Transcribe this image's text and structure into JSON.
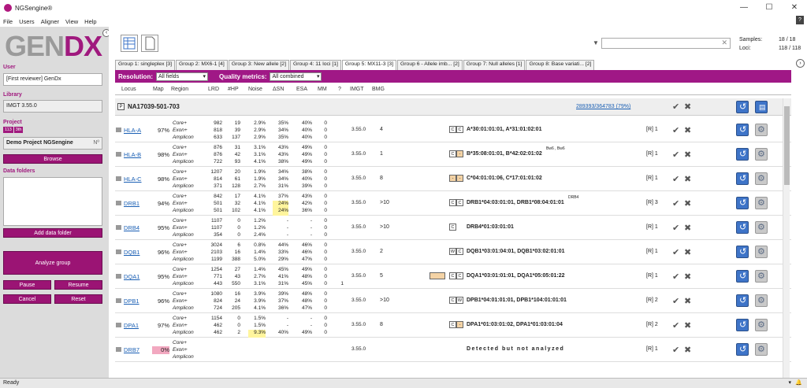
{
  "window": {
    "title": "NGSengine®",
    "min": "—",
    "max": "☐",
    "close": "✕"
  },
  "menu": [
    "File",
    "Users",
    "Aligner",
    "View",
    "Help"
  ],
  "help_icon": "?",
  "logo": {
    "a": "GEN",
    "b": "DX"
  },
  "sidebar": {
    "user_label": "User",
    "user_value": "[First reviewer] GenDx",
    "library_label": "Library",
    "library_value": "IMGT 3.55.0",
    "project_label": "Project",
    "project_badges": [
      "113",
      "3th"
    ],
    "project_value": "Demo Project NGSengine",
    "project_suffix": "Nº",
    "browse": "Browse",
    "data_folders_label": "Data folders",
    "add_data_folder": "Add data folder",
    "analyze_group": "Analyze group",
    "pause": "Pause",
    "resume": "Resume",
    "cancel": "Cancel",
    "reset": "Reset"
  },
  "counts": {
    "samples_label": "Samples:",
    "samples_value": "18 / 18",
    "loci_label": "Loci:",
    "loci_value": "118 / 118"
  },
  "tabs": [
    "Group 1: singleplex [3]",
    "Group 2: MX6-1 [4]",
    "Group 3: New allele [2]",
    "Group 4: 11 loci [1]",
    "Group 5: MX11-3 [3]",
    "Group 6 - Allele imb... [2]",
    "Group 7: Null alleles [1]",
    "Group 8: Base variati... [2]"
  ],
  "active_tab": 4,
  "filters": {
    "resolution_label": "Resolution:",
    "resolution_value": "All fields",
    "quality_label": "Quality metrics:",
    "quality_value": "All combined"
  },
  "columns": [
    "Locus",
    "Map",
    "Region",
    "LRD",
    "#HP",
    "Noise",
    "ΔSN",
    "ESA",
    "MM",
    "?",
    "IMGT",
    "BMG"
  ],
  "sample": {
    "name": "NA17039-501-703",
    "link": "289393/364783 (79%)"
  },
  "regions": [
    "Core+",
    "Exon+",
    "Amplicon"
  ],
  "loci": [
    {
      "name": "HLA-A",
      "map": "97%",
      "rows": [
        [
          "982",
          "19",
          "2.9%",
          "35%",
          "40%",
          "0"
        ],
        [
          "818",
          "39",
          "2.9%",
          "34%",
          "40%",
          "0"
        ],
        [
          "633",
          "137",
          "2.9%",
          "35%",
          "40%",
          "0"
        ]
      ],
      "imgt": "3.55.0",
      "bmg": "4",
      "tags": [
        "C",
        "C"
      ],
      "allele": "A*30:01:01:01, A*31:01:02:01",
      "sup": "",
      "rcode": "[R] 1"
    },
    {
      "name": "HLA-B",
      "map": "98%",
      "rows": [
        [
          "876",
          "31",
          "3.1%",
          "43%",
          "49%",
          "0"
        ],
        [
          "876",
          "42",
          "3.1%",
          "43%",
          "49%",
          "0"
        ],
        [
          "722",
          "93",
          "4.1%",
          "38%",
          "49%",
          "0"
        ]
      ],
      "imgt": "3.55.0",
      "bmg": "1",
      "tags": [
        "C",
        "-"
      ],
      "allele": "B*35:08:01:01, B*42:02:01:02",
      "sup": "Bw6 , Bw6",
      "rcode": "[R] 1"
    },
    {
      "name": "HLA-C",
      "map": "98%",
      "rows": [
        [
          "1207",
          "20",
          "1.9%",
          "34%",
          "38%",
          "0"
        ],
        [
          "814",
          "61",
          "1.9%",
          "34%",
          "40%",
          "0"
        ],
        [
          "371",
          "128",
          "2.7%",
          "31%",
          "39%",
          "0"
        ]
      ],
      "imgt": "3.55.0",
      "bmg": "8",
      "tags": [
        "-",
        "-"
      ],
      "allele": "C*04:01:01:06, C*17:01:01:02",
      "sup": "",
      "rcode": "[R] 1"
    },
    {
      "name": "DRB1",
      "map": "94%",
      "rows": [
        [
          "842",
          "17",
          "4.1%",
          "37%",
          "43%",
          "0"
        ],
        [
          "501",
          "32",
          "4.1%",
          "24%",
          "42%",
          "0"
        ],
        [
          "501",
          "102",
          "4.1%",
          "24%",
          "36%",
          "0"
        ]
      ],
      "imgt": "3.55.0",
      "bmg": ">10",
      "tags": [
        "C",
        "C"
      ],
      "allele": "DRB1*04:03:01:01, DRB1*08:04:01:01",
      "sup": "DRB4",
      "rcode": "[R] 3"
    },
    {
      "name": "DRB4",
      "map": "95%",
      "rows": [
        [
          "1107",
          "0",
          "1.2%",
          "-",
          "-",
          "0"
        ],
        [
          "1107",
          "0",
          "1.2%",
          "-",
          "-",
          "0"
        ],
        [
          "354",
          "0",
          "2.4%",
          "-",
          "-",
          "0"
        ]
      ],
      "imgt": "3.55.0",
      "bmg": ">10",
      "tags": [
        "C"
      ],
      "allele": "DRB4*01:03:01:01",
      "sup": "",
      "rcode": "[R] 1"
    },
    {
      "name": "DQB1",
      "map": "96%",
      "rows": [
        [
          "3024",
          "6",
          "0.8%",
          "44%",
          "46%",
          "0"
        ],
        [
          "2103",
          "16",
          "1.4%",
          "33%",
          "46%",
          "0"
        ],
        [
          "1199",
          "388",
          "5.0%",
          "29%",
          "47%",
          "0"
        ]
      ],
      "imgt": "3.55.0",
      "bmg": "2",
      "tags": [
        "W",
        "C"
      ],
      "allele": "DQB1*03:01:04:01, DQB1*03:02:01:01",
      "sup": "",
      "rcode": "[R] 1"
    },
    {
      "name": "DQA1",
      "map": "95%",
      "rows": [
        [
          "1254",
          "27",
          "1.4%",
          "45%",
          "49%",
          "0"
        ],
        [
          "771",
          "43",
          "2.7%",
          "41%",
          "48%",
          "0"
        ],
        [
          "443",
          "550",
          "3.1%",
          "31%",
          "45%",
          "0"
        ]
      ],
      "imgt": "3.55.0",
      "bmg": "5",
      "tags": [
        "C",
        "C"
      ],
      "allele": "DQA1*03:01:01:01, DQA1*05:05:01:22",
      "sup": "",
      "rcode": "[R] 1",
      "extra": "1"
    },
    {
      "name": "DPB1",
      "map": "96%",
      "rows": [
        [
          "1080",
          "16",
          "3.9%",
          "39%",
          "48%",
          "0"
        ],
        [
          "824",
          "24",
          "3.9%",
          "37%",
          "48%",
          "0"
        ],
        [
          "724",
          "205",
          "4.1%",
          "36%",
          "47%",
          "0"
        ]
      ],
      "imgt": "3.55.0",
      "bmg": ">10",
      "tags": [
        "C",
        "W"
      ],
      "allele": "DPB1*04:01:01:01, DPB1*104:01:01:01",
      "sup": "",
      "rcode": "[R] 2"
    },
    {
      "name": "DPA1",
      "map": "97%",
      "rows": [
        [
          "1154",
          "0",
          "1.5%",
          "-",
          "-",
          "0"
        ],
        [
          "462",
          "0",
          "1.5%",
          "-",
          "-",
          "0"
        ],
        [
          "462",
          "2",
          "9.3%",
          "40%",
          "49%",
          "0"
        ]
      ],
      "imgt": "3.55.0",
      "bmg": "8",
      "tags": [
        "C",
        "-"
      ],
      "allele": "DPA1*01:03:01:02, DPA1*01:03:01:04",
      "sup": "",
      "rcode": "[R] 2"
    },
    {
      "name": "DRB7",
      "map": "0%",
      "rows": [
        [
          "",
          "",
          "",
          "",
          "",
          ""
        ],
        [
          "",
          "",
          "",
          "",
          "",
          ""
        ],
        [
          "",
          "",
          "",
          "",
          "",
          ""
        ]
      ],
      "imgt": "3.55.0",
      "bmg": "",
      "tags": [],
      "allele": "Detected but not analyzed",
      "sup": "",
      "rcode": "[R] 1"
    }
  ],
  "status": "Ready",
  "colors": {
    "brand": "#a01886",
    "link": "#1a5fb4"
  }
}
